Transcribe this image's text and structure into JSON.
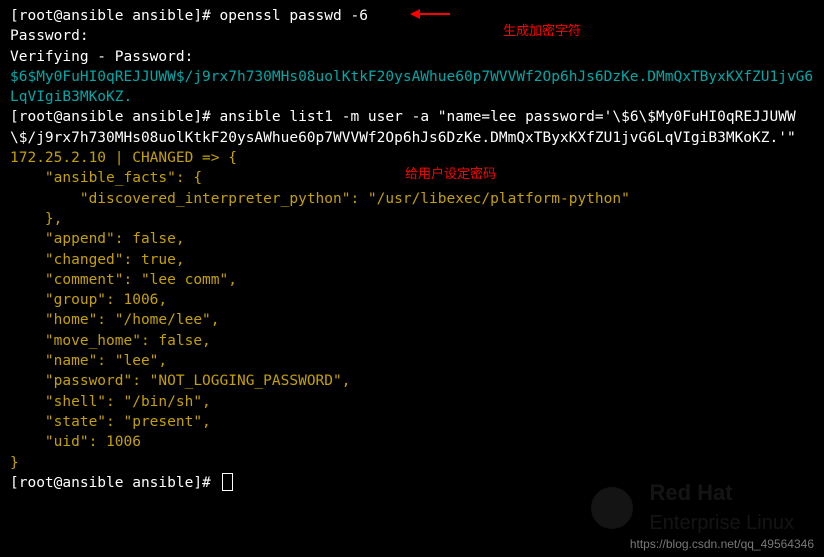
{
  "prompt": "[root@ansible ansible]#",
  "cmd1": "openssl passwd -6",
  "annot1": "生成加密字符",
  "pw_prompt": "Password:",
  "verify_prompt": "Verifying - Password:",
  "hash_output": "$6$My0FuHI0qREJJUWW$/j9rx7h730MHs08uolKtkF20ysAWhue60p7WVVWf2Op6hJs6DzKe.DMmQxTByxKXfZU1jvG6LqVIgiB3MKoKZ.",
  "cmd2": "ansible list1 -m user -a \"name=lee password='\\$6\\$My0FuHI0qREJJUWW\\$/j9rx7h730MHs08uolKtkF20ysAWhue60p7WVVWf2Op6hJs6DzKe.DMmQxTByxKXfZU1jvG6LqVIgiB3MKoKZ.'\"",
  "annot2": "给用户设定密码",
  "result_header": "172.25.2.10 | CHANGED => {",
  "json_lines": {
    "l1": "    \"ansible_facts\": {",
    "l2": "        \"discovered_interpreter_python\": \"/usr/libexec/platform-python\"",
    "l3": "    },",
    "l4": "    \"append\": false,",
    "l5": "    \"changed\": true,",
    "l6": "    \"comment\": \"lee comm\",",
    "l7": "    \"group\": 1006,",
    "l8": "    \"home\": \"/home/lee\",",
    "l9": "    \"move_home\": false,",
    "l10": "    \"name\": \"lee\",",
    "l11": "    \"password\": \"NOT_LOGGING_PASSWORD\",",
    "l12": "    \"shell\": \"/bin/sh\",",
    "l13": "    \"state\": \"present\",",
    "l14": "    \"uid\": 1006",
    "l15": "}"
  },
  "watermark": {
    "line1": "Red Hat",
    "line2": "Enterprise Linux"
  },
  "footer_url": "https://blog.csdn.net/qq_49564346"
}
